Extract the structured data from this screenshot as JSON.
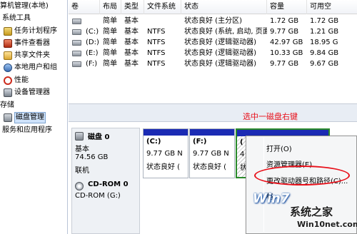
{
  "tree": {
    "items": [
      {
        "label": "算机管理(本地)",
        "icon": "computer-management-icon"
      },
      {
        "label": "系统工具",
        "icon": ""
      },
      {
        "label": "任务计划程序",
        "icon": "task-scheduler-icon"
      },
      {
        "label": "事件查看器",
        "icon": "event-viewer-icon"
      },
      {
        "label": "共享文件夹",
        "icon": "shared-folders-icon"
      },
      {
        "label": "本地用户和组",
        "icon": "local-users-icon"
      },
      {
        "label": "性能",
        "icon": "performance-icon"
      },
      {
        "label": "设备管理器",
        "icon": "device-manager-icon"
      },
      {
        "label": "存储",
        "icon": ""
      },
      {
        "label": "磁盘管理",
        "icon": "disk-management-icon"
      },
      {
        "label": "服务和应用程序",
        "icon": ""
      }
    ]
  },
  "volume_list": {
    "columns": [
      "卷",
      "布局",
      "类型",
      "文件系统",
      "状态",
      "容量",
      "可用空"
    ],
    "rows": [
      {
        "volume": "",
        "layout": "简单",
        "type": "基本",
        "fs": "",
        "status": "状态良好 (主分区)",
        "capacity": "1.72 GB",
        "free": "1.72 GB"
      },
      {
        "volume": "(C:)",
        "layout": "简单",
        "type": "基本",
        "fs": "NTFS",
        "status": "状态良好 (系统, 启动, 页面...",
        "capacity": "9.77 GB",
        "free": "1.21 GB"
      },
      {
        "volume": "(D:)",
        "layout": "简单",
        "type": "基本",
        "fs": "NTFS",
        "status": "状态良好 (逻辑驱动器)",
        "capacity": "42.97 GB",
        "free": "18.95 G"
      },
      {
        "volume": "(E:)",
        "layout": "简单",
        "type": "基本",
        "fs": "NTFS",
        "status": "状态良好 (逻辑驱动器)",
        "capacity": "10.33 GB",
        "free": "9.84 GB"
      },
      {
        "volume": "(F:)",
        "layout": "简单",
        "type": "基本",
        "fs": "NTFS",
        "status": "状态良好 (逻辑驱动器)",
        "capacity": "9.77 GB",
        "free": "9.67 GB"
      }
    ]
  },
  "disk0": {
    "name": "磁盘 0",
    "type": "基本",
    "size": "74.56 GB",
    "state": "联机",
    "partitions": [
      {
        "name": "(C:)",
        "size": "9.77 GB N",
        "status": "状态良好 ("
      },
      {
        "name": "(F:)",
        "size": "9.77 GB N",
        "status": "状态良好 ("
      },
      {
        "name": "(",
        "size": "4",
        "status": "状"
      }
    ]
  },
  "cdrom0": {
    "name": "CD-ROM 0",
    "drive": "CD-ROM (G:)"
  },
  "context_menu": {
    "items": [
      "打开(O)",
      "资源管理器(E)",
      "更改驱动器号和路径(C)...",
      "格"
    ]
  },
  "annotation": {
    "text": "选中一磁盘右键"
  },
  "watermark": {
    "logo": "Win7",
    "site_name": "系统之家",
    "url": "Win10net.com"
  },
  "colors": {
    "partition_bar": "#1b2bb4",
    "annotation": "#e8101a",
    "selection": "#cfe3fb"
  }
}
